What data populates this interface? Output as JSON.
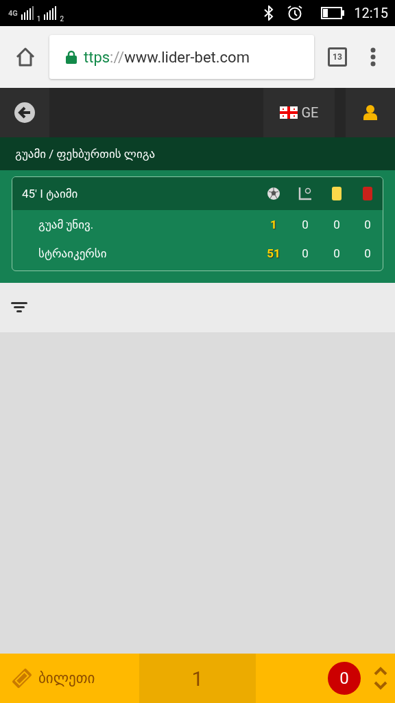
{
  "status_bar": {
    "network": "4G",
    "sim_1": "1",
    "sim_2": "2",
    "time": "12:15"
  },
  "browser": {
    "url_scheme": "ttps",
    "url_separator": "://",
    "url_host": "www.lider-bet.com",
    "tab_count": "13"
  },
  "header": {
    "language": "GE"
  },
  "breadcrumb": "გუამი / ფეხბურთის ლიგა",
  "match": {
    "period": "45' I ტაიმი",
    "teams": [
      {
        "name": "გუამ უნივ.",
        "goals": "1",
        "corners": "0",
        "cautions": "0",
        "sending_offs": "0"
      },
      {
        "name": "სტრაიკერსი",
        "goals": "51",
        "corners": "0",
        "cautions": "0",
        "sending_offs": "0"
      }
    ]
  },
  "bottom_bar": {
    "ticket_label": "ბილეთი",
    "count": "1",
    "badge": "0"
  }
}
